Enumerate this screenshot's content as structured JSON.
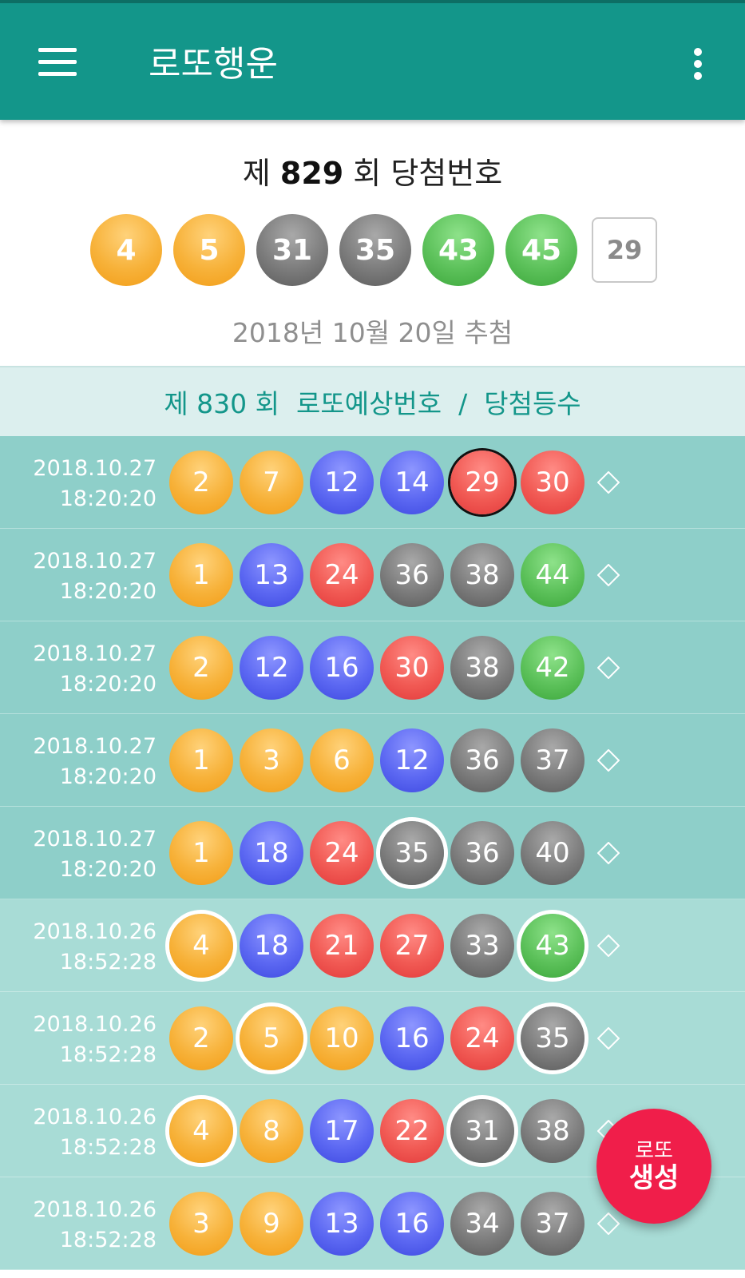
{
  "appbar": {
    "title": "로또행운"
  },
  "winning": {
    "title_prefix": "제 ",
    "draw_no": "829",
    "title_suffix": " 회 당첨번호",
    "balls": [
      {
        "n": "4",
        "color": "yellow"
      },
      {
        "n": "5",
        "color": "yellow"
      },
      {
        "n": "31",
        "color": "gray"
      },
      {
        "n": "35",
        "color": "gray"
      },
      {
        "n": "43",
        "color": "green"
      },
      {
        "n": "45",
        "color": "green"
      }
    ],
    "bonus": "29",
    "date": "2018년 10월 20일  추첨"
  },
  "prediction_header": "제 830 회  로또예상번호  /  당첨등수",
  "rows": [
    {
      "date": "2018.10.27",
      "time": "18:20:20",
      "shade": "dark",
      "balls": [
        {
          "n": "2",
          "c": "yellow"
        },
        {
          "n": "7",
          "c": "yellow"
        },
        {
          "n": "12",
          "c": "blue"
        },
        {
          "n": "14",
          "c": "blue"
        },
        {
          "n": "29",
          "c": "red",
          "ring": "b"
        },
        {
          "n": "30",
          "c": "red"
        }
      ]
    },
    {
      "date": "2018.10.27",
      "time": "18:20:20",
      "shade": "dark",
      "balls": [
        {
          "n": "1",
          "c": "yellow"
        },
        {
          "n": "13",
          "c": "blue"
        },
        {
          "n": "24",
          "c": "red"
        },
        {
          "n": "36",
          "c": "gray"
        },
        {
          "n": "38",
          "c": "gray"
        },
        {
          "n": "44",
          "c": "green"
        }
      ]
    },
    {
      "date": "2018.10.27",
      "time": "18:20:20",
      "shade": "dark",
      "balls": [
        {
          "n": "2",
          "c": "yellow"
        },
        {
          "n": "12",
          "c": "blue"
        },
        {
          "n": "16",
          "c": "blue"
        },
        {
          "n": "30",
          "c": "red"
        },
        {
          "n": "38",
          "c": "gray"
        },
        {
          "n": "42",
          "c": "green"
        }
      ]
    },
    {
      "date": "2018.10.27",
      "time": "18:20:20",
      "shade": "dark",
      "balls": [
        {
          "n": "1",
          "c": "yellow"
        },
        {
          "n": "3",
          "c": "yellow"
        },
        {
          "n": "6",
          "c": "yellow"
        },
        {
          "n": "12",
          "c": "blue"
        },
        {
          "n": "36",
          "c": "gray"
        },
        {
          "n": "37",
          "c": "gray"
        }
      ]
    },
    {
      "date": "2018.10.27",
      "time": "18:20:20",
      "shade": "dark",
      "balls": [
        {
          "n": "1",
          "c": "yellow"
        },
        {
          "n": "18",
          "c": "blue"
        },
        {
          "n": "24",
          "c": "red"
        },
        {
          "n": "35",
          "c": "gray",
          "ring": "w"
        },
        {
          "n": "36",
          "c": "gray"
        },
        {
          "n": "40",
          "c": "gray"
        }
      ]
    },
    {
      "date": "2018.10.26",
      "time": "18:52:28",
      "shade": "light",
      "balls": [
        {
          "n": "4",
          "c": "yellow",
          "ring": "w"
        },
        {
          "n": "18",
          "c": "blue"
        },
        {
          "n": "21",
          "c": "red"
        },
        {
          "n": "27",
          "c": "red"
        },
        {
          "n": "33",
          "c": "gray"
        },
        {
          "n": "43",
          "c": "green",
          "ring": "w"
        }
      ]
    },
    {
      "date": "2018.10.26",
      "time": "18:52:28",
      "shade": "light",
      "balls": [
        {
          "n": "2",
          "c": "yellow"
        },
        {
          "n": "5",
          "c": "yellow",
          "ring": "w"
        },
        {
          "n": "10",
          "c": "yellow"
        },
        {
          "n": "16",
          "c": "blue"
        },
        {
          "n": "24",
          "c": "red"
        },
        {
          "n": "35",
          "c": "gray",
          "ring": "w"
        }
      ]
    },
    {
      "date": "2018.10.26",
      "time": "18:52:28",
      "shade": "light",
      "balls": [
        {
          "n": "4",
          "c": "yellow",
          "ring": "w"
        },
        {
          "n": "8",
          "c": "yellow"
        },
        {
          "n": "17",
          "c": "blue"
        },
        {
          "n": "22",
          "c": "red"
        },
        {
          "n": "31",
          "c": "gray",
          "ring": "w"
        },
        {
          "n": "38",
          "c": "gray"
        }
      ]
    },
    {
      "date": "2018.10.26",
      "time": "18:52:28",
      "shade": "light",
      "balls": [
        {
          "n": "3",
          "c": "yellow"
        },
        {
          "n": "9",
          "c": "yellow"
        },
        {
          "n": "13",
          "c": "blue"
        },
        {
          "n": "16",
          "c": "blue"
        },
        {
          "n": "34",
          "c": "gray"
        },
        {
          "n": "37",
          "c": "gray"
        }
      ]
    }
  ],
  "fab": {
    "line1": "로또",
    "line2": "생성"
  },
  "icons": {
    "menu": "hamburger-menu-icon",
    "overflow": "more-vert-icon",
    "rank": "diamond-outline-icon"
  }
}
